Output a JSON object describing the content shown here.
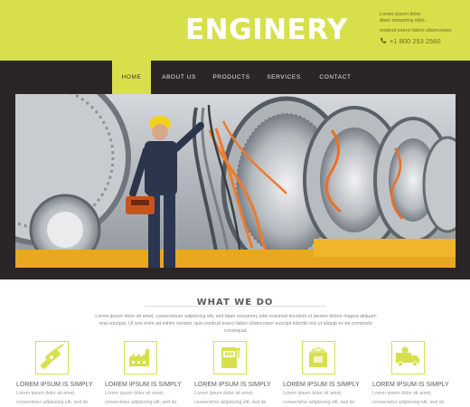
{
  "header": {
    "logo": "ENGINERY",
    "contact_lines": [
      "Lorem ipsum dolor",
      "diam nonummy nibh.",
      "nostrud exerci tation ullamcorper"
    ],
    "phone": "+1 800 253 2560",
    "background_color": "#d7e04a"
  },
  "nav": {
    "items": [
      {
        "label": "HOME",
        "active": true
      },
      {
        "label": "ABOUT US",
        "active": false
      },
      {
        "label": "PRODUCTS",
        "active": false
      },
      {
        "label": "SERVICES",
        "active": false
      },
      {
        "label": "CONTACT",
        "active": false
      }
    ],
    "background_color": "#2a2526",
    "active_color": "#d7e04a"
  },
  "hero": {
    "slide_dots": 5,
    "active_dot": 2
  },
  "what_we_do": {
    "title": "WHAT WE DO",
    "intro": "Lorem ipsum dolor sit amet, consectetuer adipiscing elit, sed diam nonummy nibh euismod tincidunt ut laoreet dolore magna aliquam erat volutpat. Ut wisi enim ad minim veniam, quis nostrud exerci tation ullamcorper suscipit lobortis nisl ut aliquip ex ea commodo consequat.",
    "features": [
      {
        "icon": "drill-icon",
        "title": "LOREM IPSUM IS SIMPLY",
        "text_lines": [
          "Lorem ipsum dolor sit amet,",
          "consectetur adipiscing elit, sed do"
        ]
      },
      {
        "icon": "factory-icon",
        "title": "LOREM IPSUM IS SIMPLY",
        "text_lines": [
          "Lorem ipsum dolor sit amet,",
          "consectetur adipiscing elit, sed do"
        ]
      },
      {
        "icon": "slot-machine-icon",
        "title": "LOREM IPSUM IS SIMPLY",
        "text_lines": [
          "Lorem ipsum dolor sit amet,",
          "consectetur adipiscing elit, sed do"
        ]
      },
      {
        "icon": "crate-icon",
        "title": "LOREM IPSUM IS SIMPLY",
        "text_lines": [
          "Lorem ipsum dolor sit amet,",
          "consectetur adipiscing elit, sed do"
        ]
      },
      {
        "icon": "delivery-truck-icon",
        "title": "LOREM IPSUM IS SIMPLY",
        "text_lines": [
          "Lorem ipsum dolor sit amet,",
          "consectetur adipiscing elit, sed do"
        ]
      }
    ],
    "accent_color": "#d7e04a"
  }
}
